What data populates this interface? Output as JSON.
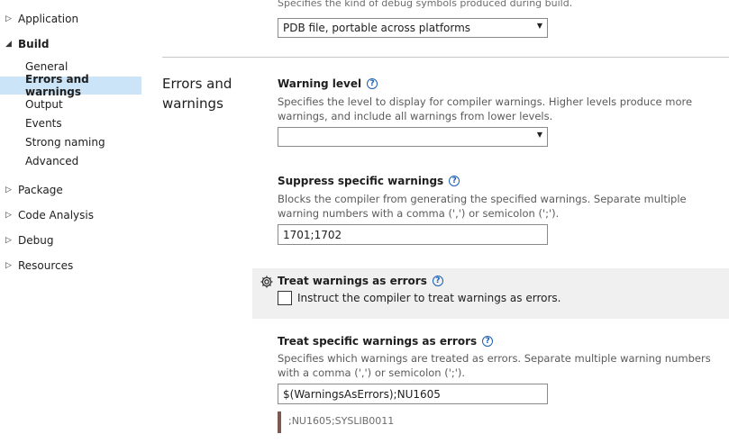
{
  "sidebar": {
    "top_items": [
      {
        "label": "Application",
        "arrow": "▷",
        "expanded": false
      },
      {
        "label": "Build",
        "arrow": "◢",
        "expanded": true
      },
      {
        "label": "Package",
        "arrow": "▷",
        "expanded": false
      },
      {
        "label": "Code Analysis",
        "arrow": "▷",
        "expanded": false
      },
      {
        "label": "Debug",
        "arrow": "▷",
        "expanded": false
      },
      {
        "label": "Resources",
        "arrow": "▷",
        "expanded": false
      }
    ],
    "build_items": [
      {
        "label": "General"
      },
      {
        "label": "Errors and warnings",
        "selected": true
      },
      {
        "label": "Output"
      },
      {
        "label": "Events"
      },
      {
        "label": "Strong naming"
      },
      {
        "label": "Advanced"
      }
    ]
  },
  "debug_symbols": {
    "description": "Specifies the kind of debug symbols produced during build.",
    "value": "PDB file, portable across platforms"
  },
  "section": {
    "title": "Errors and warnings"
  },
  "warning_level": {
    "label": "Warning level",
    "description": "Specifies the level to display for compiler warnings. Higher levels produce more warnings, and include all warnings from lower levels.",
    "value": ""
  },
  "suppress_warnings": {
    "label": "Suppress specific warnings",
    "description": "Blocks the compiler from generating the specified warnings. Separate multiple warning numbers with a comma (',') or semicolon (';').",
    "value": "1701;1702"
  },
  "treat_warnings_as_errors": {
    "label": "Treat warnings as errors",
    "checkbox_label": "Instruct the compiler to treat warnings as errors.",
    "checked": false
  },
  "treat_specific_warnings": {
    "label": "Treat specific warnings as errors",
    "description": "Specifies which warnings are treated as errors. Separate multiple warning numbers with a comma (',') or semicolon (';').",
    "value": "$(WarningsAsErrors);NU1605",
    "evaluated_value": ";NU1605;SYSLIB0011"
  },
  "colors": {
    "selected_bg": "#cce4f7",
    "highlight_bg": "#f0f0f0",
    "help_icon": "#1a5fb4",
    "hint_bar": "#7d5a50"
  },
  "icons": {
    "help": "help-circle-icon",
    "gear": "gear-icon",
    "dropdown": "chevron-down-icon",
    "collapsed": "triangle-right-icon",
    "expanded": "triangle-down-icon"
  }
}
